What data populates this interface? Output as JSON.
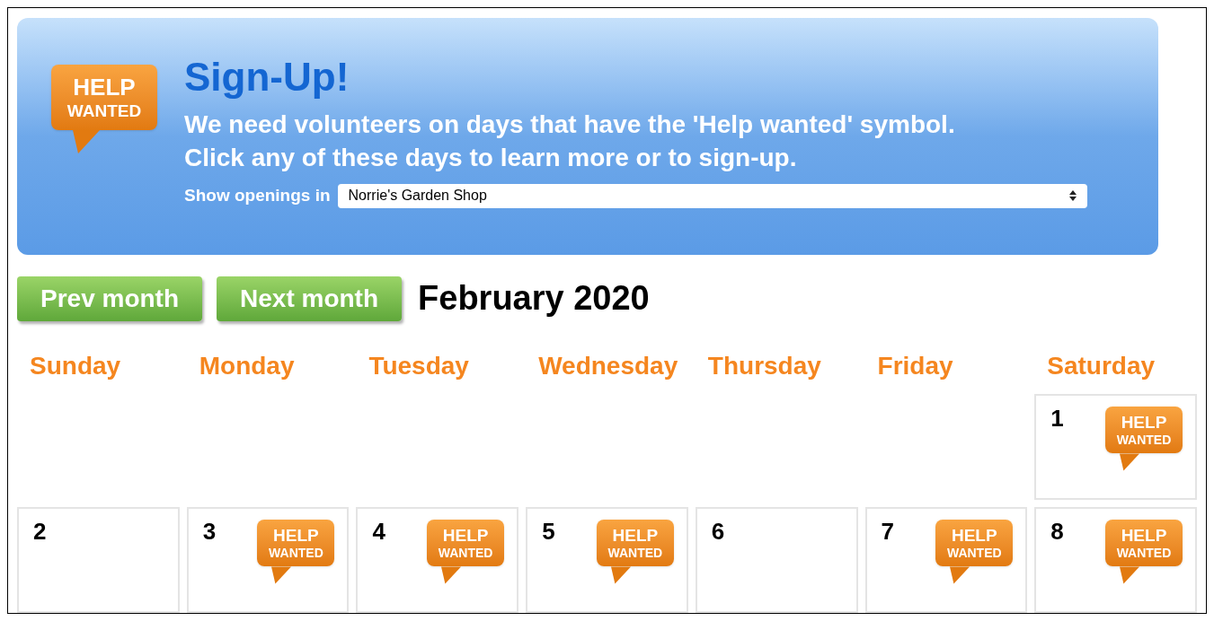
{
  "banner": {
    "badge": [
      "HELP",
      "WANTED"
    ],
    "title": "Sign-Up!",
    "lines": [
      "We need volunteers on days that have the 'Help wanted' symbol.",
      "Click any of these days to learn more or to sign-up."
    ],
    "filter": {
      "label": "Show openings in",
      "value": "Norrie's Garden Shop"
    }
  },
  "nav": {
    "buttons": [
      "Prev month",
      "Next month"
    ],
    "month": "February 2020"
  },
  "weekdays": [
    "Sunday",
    "Monday",
    "Tuesday",
    "Wednesday",
    "Thursday",
    "Friday",
    "Saturday"
  ],
  "weeks": [
    [
      {
        "kind": "blank"
      },
      {
        "kind": "blank"
      },
      {
        "kind": "blank"
      },
      {
        "kind": "blank"
      },
      {
        "kind": "blank"
      },
      {
        "kind": "blank"
      },
      {
        "kind": "day",
        "day": "1",
        "badge": [
          "HELP",
          "WANTED"
        ]
      }
    ],
    [
      {
        "kind": "day",
        "day": "2"
      },
      {
        "kind": "day",
        "day": "3",
        "badge": [
          "HELP",
          "WANTED"
        ]
      },
      {
        "kind": "day",
        "day": "4",
        "badge": [
          "HELP",
          "WANTED"
        ]
      },
      {
        "kind": "day",
        "day": "5",
        "badge": [
          "HELP",
          "WANTED"
        ]
      },
      {
        "kind": "day",
        "day": "6"
      },
      {
        "kind": "day",
        "day": "7",
        "badge": [
          "HELP",
          "WANTED"
        ]
      },
      {
        "kind": "day",
        "day": "8",
        "badge": [
          "HELP",
          "WANTED"
        ]
      }
    ]
  ]
}
